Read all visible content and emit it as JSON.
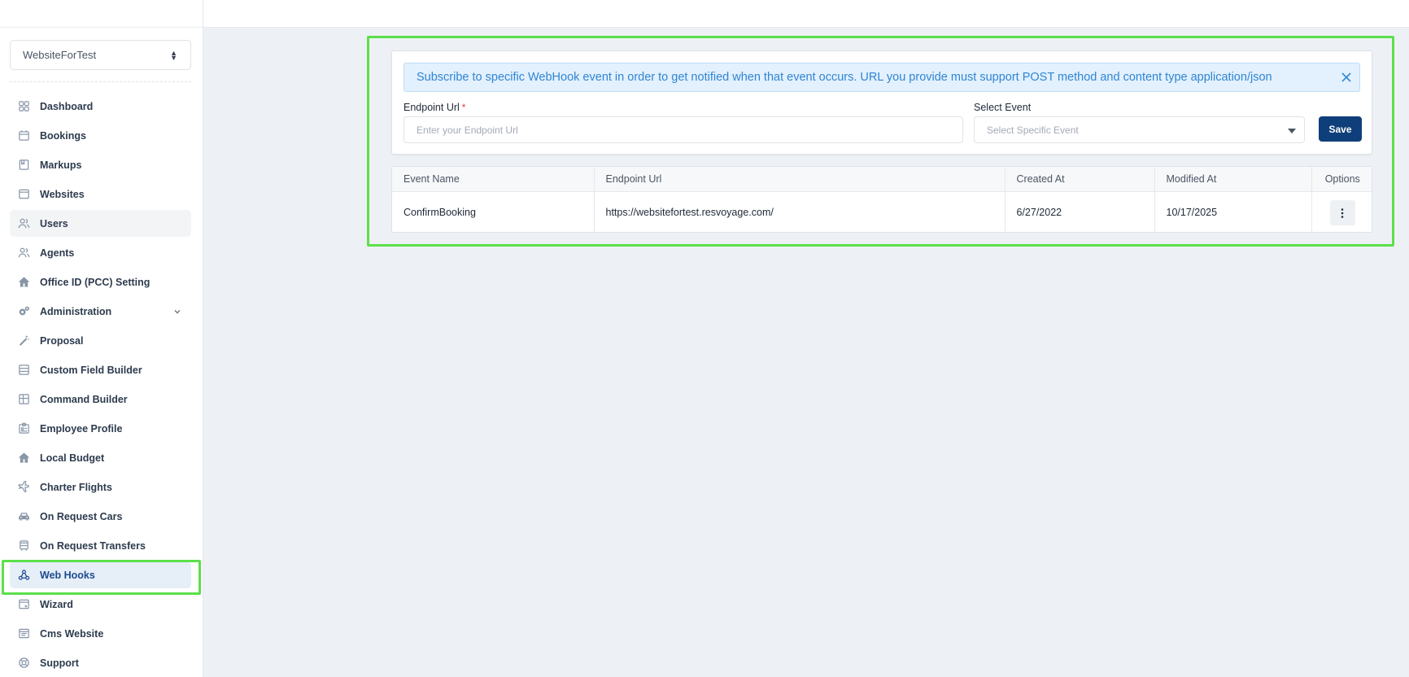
{
  "sidebar": {
    "site_selector": "WebsiteForTest",
    "items": [
      {
        "label": "Dashboard",
        "icon": "dashboard-icon"
      },
      {
        "label": "Bookings",
        "icon": "calendar-icon"
      },
      {
        "label": "Markups",
        "icon": "markup-icon"
      },
      {
        "label": "Websites",
        "icon": "window-icon"
      },
      {
        "label": "Users",
        "icon": "users-icon"
      },
      {
        "label": "Agents",
        "icon": "users-icon"
      },
      {
        "label": "Office ID (PCC) Setting",
        "icon": "home-icon"
      },
      {
        "label": "Administration",
        "icon": "gears-icon"
      },
      {
        "label": "Proposal",
        "icon": "magic-wand-icon"
      },
      {
        "label": "Custom Field Builder",
        "icon": "form-icon"
      },
      {
        "label": "Command Builder",
        "icon": "grid-icon"
      },
      {
        "label": "Employee Profile",
        "icon": "id-card-icon"
      },
      {
        "label": "Local Budget",
        "icon": "home-icon"
      },
      {
        "label": "Charter Flights",
        "icon": "plane-icon"
      },
      {
        "label": "On Request Cars",
        "icon": "car-icon"
      },
      {
        "label": "On Request Transfers",
        "icon": "bus-icon"
      },
      {
        "label": "Web Hooks",
        "icon": "webhook-icon"
      },
      {
        "label": "Wizard",
        "icon": "wizard-icon"
      },
      {
        "label": "Cms Website",
        "icon": "cms-icon"
      },
      {
        "label": "Support",
        "icon": "lifebuoy-icon"
      }
    ],
    "active": "Web Hooks",
    "hover": "Users"
  },
  "webhook_form": {
    "alert_text": "Subscribe to specific WebHook event in order to get notified when that event occurs. URL you provide must support POST method and content type application/json",
    "endpoint_label": "Endpoint Url",
    "endpoint_required_mark": "*",
    "endpoint_placeholder": "Enter your Endpoint Url",
    "event_label": "Select Event",
    "event_placeholder": "Select Specific Event",
    "save_label": "Save"
  },
  "webhook_table": {
    "columns": [
      "Event Name",
      "Endpoint Url",
      "Created At",
      "Modified At",
      "Options"
    ],
    "rows": [
      {
        "event_name": "ConfirmBooking",
        "endpoint_url": "https://websitefortest.resvoyage.com/",
        "created_at": "6/27/2022",
        "modified_at": "10/17/2025"
      }
    ]
  },
  "colors": {
    "primary": "#0f3f7a",
    "alert_bg": "#e3f0fd",
    "alert_text": "#2f86d4",
    "highlight": "#5be04a",
    "active_bg": "#e6eef8"
  }
}
